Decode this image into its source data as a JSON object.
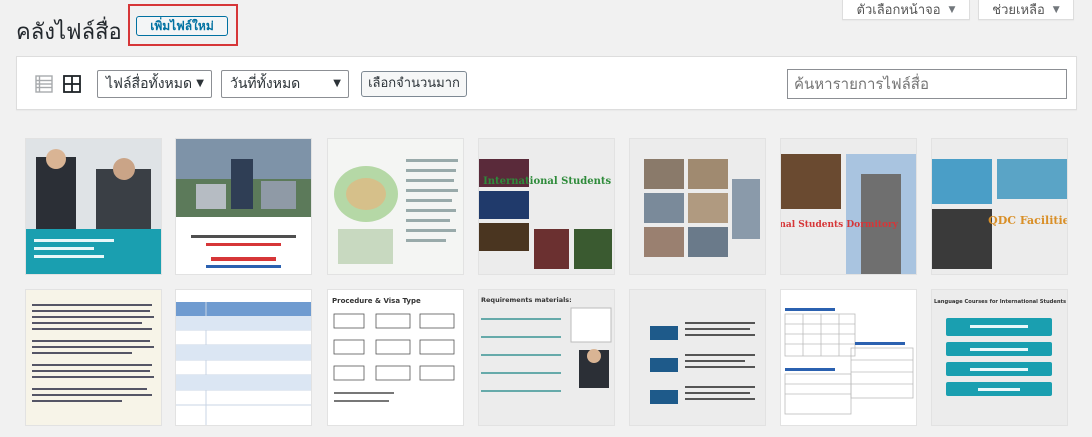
{
  "screen_options": {
    "label": "ตัวเลือกหน้าจอ"
  },
  "help": {
    "label": "ช่วยเหลือ"
  },
  "page": {
    "title": "คลังไฟล์สื่อ",
    "add_new": "เพิ่มไฟล์ใหม่"
  },
  "toolbar": {
    "type_filter": "ไฟล์สื่อทั้งหมด",
    "date_filter": "วันที่ทั้งหมด",
    "bulk_select": "เลือกจำนวนมาก",
    "search_placeholder": "ค้นหารายการไฟล์สื่อ"
  },
  "thumbnails": {
    "row1": [
      {
        "name": "students-portrait",
        "text": ""
      },
      {
        "name": "campus-aerial",
        "text": "Contact: Abby Gu, International Center of QDC"
      },
      {
        "name": "campus-map",
        "text": ""
      },
      {
        "name": "international-students-activities",
        "text": "International Students Activities"
      },
      {
        "name": "classroom-collage",
        "text": ""
      },
      {
        "name": "international-students-dormitory",
        "text": "International Students Dormitory"
      },
      {
        "name": "qdc-facilities",
        "text": "QDC Facilities"
      }
    ],
    "row2": [
      {
        "name": "university-intro-text",
        "text": ""
      },
      {
        "name": "dormitory-fee-table",
        "text": ""
      },
      {
        "name": "procedure-visa-type",
        "text": "Procedure & Visa Type"
      },
      {
        "name": "requirements-materials",
        "text": "Requirements materials:"
      },
      {
        "name": "program-levels",
        "text": ""
      },
      {
        "name": "chinese-language-class",
        "text": ""
      },
      {
        "name": "language-courses",
        "text": "Language Courses for International Students"
      }
    ]
  },
  "colors": {
    "accent": "#0071a1",
    "highlight": "#d63638",
    "teal": "#1a9fb0"
  }
}
